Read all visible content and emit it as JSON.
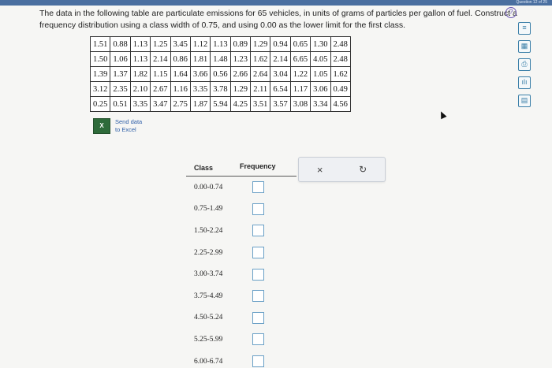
{
  "header": {
    "label": "Question 12 of 25"
  },
  "question": {
    "text": "The data in the following table are particulate emissions for 65 vehicles, in units of grams of particles per gallon of fuel. Construct a frequency distribution using a class width of 0.75, and using 0.00 as the lower limit for the first class."
  },
  "data_table": {
    "rows": [
      [
        "1.51",
        "0.88",
        "1.13",
        "1.25",
        "3.45",
        "1.12",
        "1.13",
        "0.89",
        "1.29",
        "0.94",
        "0.65",
        "1.30",
        "2.48"
      ],
      [
        "1.50",
        "1.06",
        "1.13",
        "2.14",
        "0.86",
        "1.81",
        "1.48",
        "1.23",
        "1.62",
        "2.14",
        "6.65",
        "4.05",
        "2.48"
      ],
      [
        "1.39",
        "1.37",
        "1.82",
        "1.15",
        "1.64",
        "3.66",
        "0.56",
        "2.66",
        "2.64",
        "3.04",
        "1.22",
        "1.05",
        "1.62"
      ],
      [
        "3.12",
        "2.35",
        "2.10",
        "2.67",
        "1.16",
        "3.35",
        "3.78",
        "1.29",
        "2.11",
        "6.54",
        "1.17",
        "3.06",
        "0.49"
      ],
      [
        "0.25",
        "0.51",
        "3.35",
        "3.47",
        "2.75",
        "1.87",
        "5.94",
        "4.25",
        "3.51",
        "3.57",
        "3.08",
        "3.34",
        "4.56"
      ]
    ]
  },
  "excel": {
    "icon_text": "X",
    "line1": "Send data",
    "line2": "to Excel"
  },
  "frequency_table": {
    "col_class": "Class",
    "col_frequency": "Frequency",
    "classes": [
      "0.00-0.74",
      "0.75-1.49",
      "1.50-2.24",
      "2.25-2.99",
      "3.00-3.74",
      "3.75-4.49",
      "4.50-5.24",
      "5.25-5.99",
      "6.00-6.74"
    ]
  },
  "actions": {
    "clear_symbol": "×",
    "redo_symbol": "↻"
  },
  "help": {
    "symbol": "?"
  },
  "tools": [
    "≡",
    "▦",
    "⎙",
    "ılı",
    "▤"
  ],
  "colors": {
    "accent": "#6aa0c6",
    "help": "#6b57b5",
    "tools": "#3b7fa8"
  }
}
